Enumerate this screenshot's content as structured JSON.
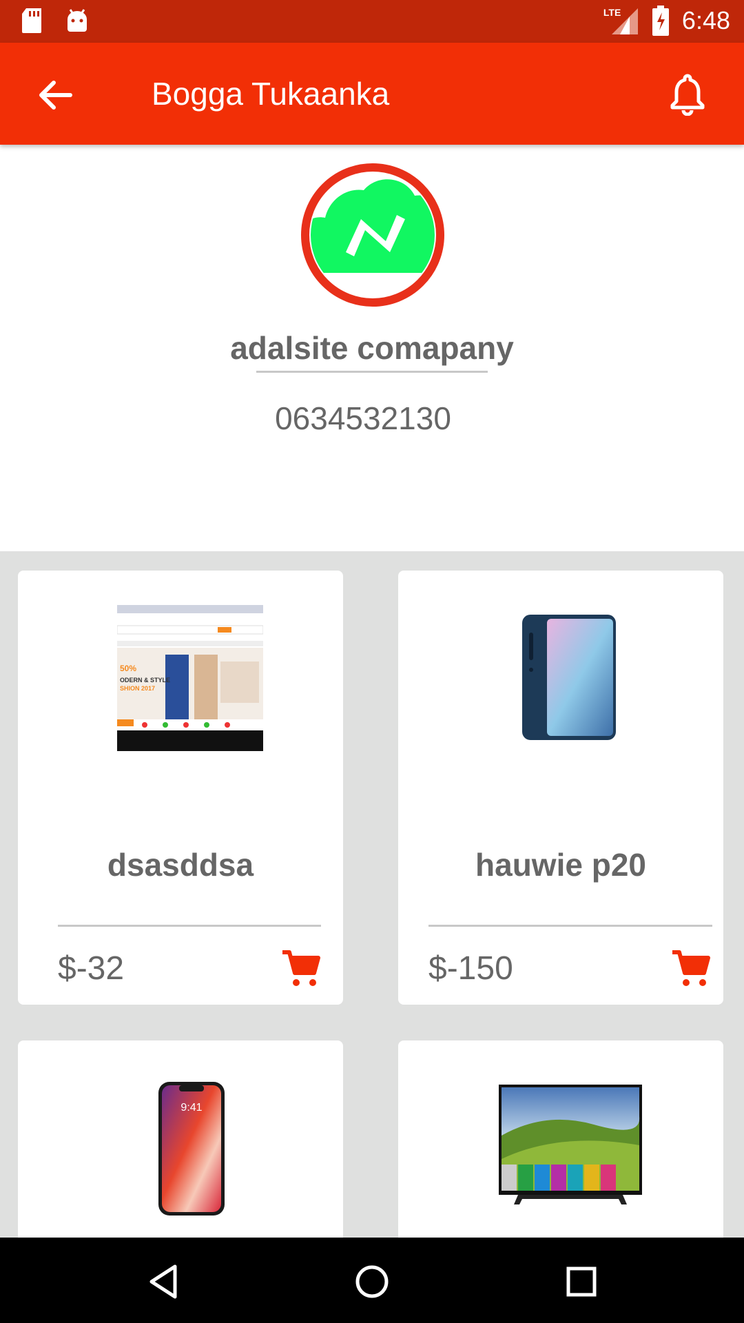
{
  "status_bar": {
    "time": "6:48",
    "network": "LTE",
    "icons": [
      "sd-card-icon",
      "android-icon",
      "signal-icon",
      "battery-charging-icon"
    ]
  },
  "app_bar": {
    "title": "Bogga Tukaanka",
    "back_icon": "arrow-back-icon",
    "notification_icon": "bell-icon"
  },
  "profile": {
    "company_name": "adalsite comapany",
    "phone": "0634532130",
    "logo_letter": "N"
  },
  "products": [
    {
      "name": "dsasddsa",
      "price": "$-32",
      "image": "fashion-website-thumbnail"
    },
    {
      "name": "hauwie p20",
      "price": "$-150",
      "image": "smartphone-blue"
    },
    {
      "name": "",
      "price": "",
      "image": "iphone-x"
    },
    {
      "name": "",
      "price": "",
      "image": "smart-tv"
    }
  ],
  "iphone_time": "9:41",
  "colors": {
    "status_bar": "#bf2709",
    "app_bar": "#f22f06",
    "accent": "#f22f06",
    "logo_green": "#11f761",
    "grid_background": "#dfe0df"
  }
}
